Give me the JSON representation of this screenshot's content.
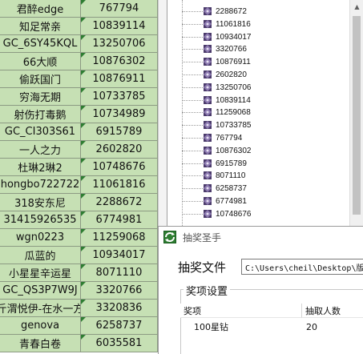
{
  "sheet": {
    "rows": [
      {
        "name": "君醉edge",
        "value": "767794"
      },
      {
        "name": "知足常亲",
        "value": "10839114"
      },
      {
        "name": "GC_6SY45KQL",
        "value": "13250706"
      },
      {
        "name": "66大顺",
        "value": "10876302"
      },
      {
        "name": "偷跃国门",
        "value": "10876911"
      },
      {
        "name": "穷海无期",
        "value": "10733785"
      },
      {
        "name": "射伤打毒鹅",
        "value": "10734989"
      },
      {
        "name": "GC_CI303S61",
        "value": "6915789"
      },
      {
        "name": "一人之力",
        "value": "2602820"
      },
      {
        "name": "杜琳2琳2",
        "value": "10748676"
      },
      {
        "name": "hongbo722722",
        "value": "11061816"
      },
      {
        "name": "318安东尼",
        "value": "2288672"
      },
      {
        "name": "31415926535",
        "value": "6774981"
      },
      {
        "name": "wgn0223",
        "value": "11259068"
      },
      {
        "name": "瓜蓝的",
        "value": "10934017"
      },
      {
        "name": "小星星辛运星",
        "value": "8071110"
      },
      {
        "name": "GC_QS3P7W9J",
        "value": "3320766"
      },
      {
        "name": "斤渭悦伊-在水一方",
        "value": "3320836"
      },
      {
        "name": "genova",
        "value": "6258737"
      },
      {
        "name": "青春白卷",
        "value": "6035581"
      }
    ]
  },
  "tree": {
    "items": [
      "2288672",
      "11061816",
      "10934017",
      "3320766",
      "10876911",
      "2602820",
      "13250706",
      "10839114",
      "11259068",
      "10733785",
      "767794",
      "10876302",
      "6915789",
      "8071110",
      "6258737",
      "6774981",
      "10748676"
    ]
  },
  "dialog": {
    "title": "抽奖圣手",
    "file_label": "抽奖文件",
    "file_path": "C:\\Users\\cheil\\Desktop\\版",
    "group_label": "奖项设置",
    "table": {
      "columns": [
        "奖项",
        "抽取人数"
      ],
      "rows": [
        [
          "100星钻",
          "20"
        ]
      ]
    }
  },
  "colors": {
    "sheet_cell": "#c6e0b4",
    "corner_mark": "#2e7d32"
  }
}
